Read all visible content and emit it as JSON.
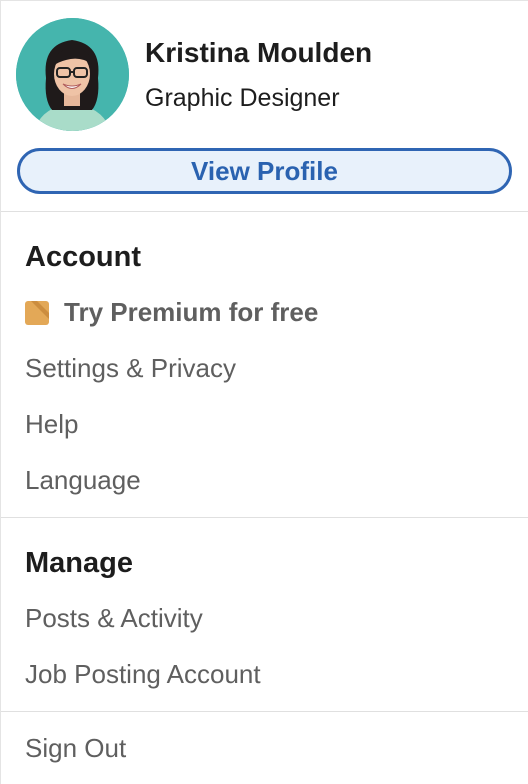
{
  "profile": {
    "name": "Kristina Moulden",
    "headline": "Graphic Designer",
    "view_profile_label": "View Profile",
    "avatar_bg": "#45b5ad"
  },
  "account": {
    "title": "Account",
    "premium_label": "Try Premium for free",
    "premium_icon": "premium-gold-icon",
    "items": [
      "Settings & Privacy",
      "Help",
      "Language"
    ]
  },
  "manage": {
    "title": "Manage",
    "items": [
      "Posts & Activity",
      "Job Posting Account"
    ]
  },
  "sign_out_label": "Sign Out",
  "colors": {
    "accent": "#2a62b0",
    "button_bg": "#e8f1fb",
    "premium_gold": "#e3a857"
  }
}
